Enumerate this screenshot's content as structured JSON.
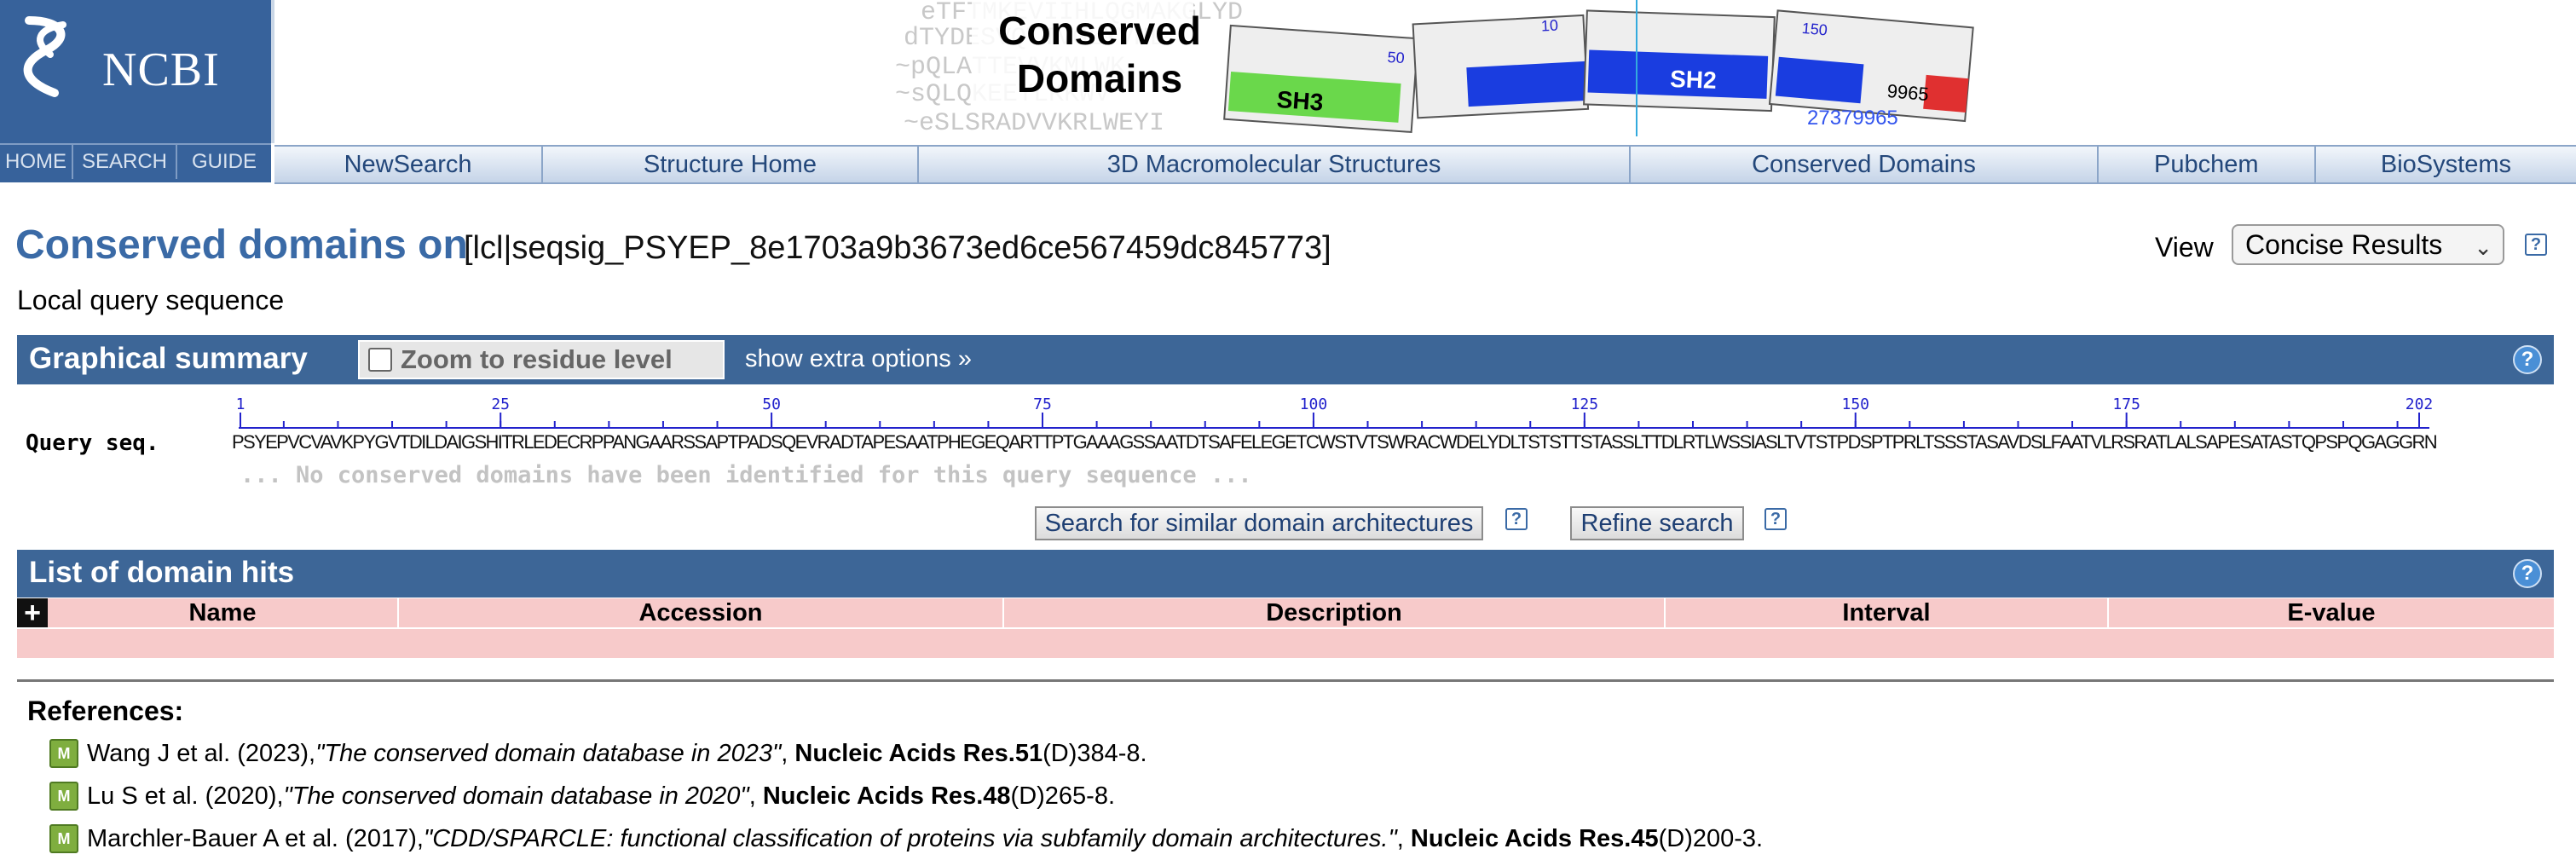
{
  "header": {
    "logo_text": "NCBI",
    "logo_nav": [
      {
        "label": "HOME"
      },
      {
        "label": "SEARCH"
      },
      {
        "label": "GUIDE"
      }
    ],
    "banner": {
      "title_line1": "Conserved",
      "title_line2": "Domains",
      "pieces": [
        "SH3",
        "SH2"
      ],
      "numbers": [
        "50",
        "10",
        "150",
        "9965",
        "27379965"
      ]
    },
    "main_nav": [
      {
        "label": "NewSearch"
      },
      {
        "label": "Structure Home"
      },
      {
        "label": "3D Macromolecular Structures"
      },
      {
        "label": "Conserved Domains"
      },
      {
        "label": "Pubchem"
      },
      {
        "label": "BioSystems"
      }
    ]
  },
  "title": {
    "heading": "Conserved domains on",
    "query_id": "[lcl|seqsig_PSYEP_8e1703a9b3673ed6ce567459dc845773]",
    "subtitle": "Local query sequence"
  },
  "view": {
    "label": "View",
    "selected": "Concise Results",
    "help": "?"
  },
  "graphical_summary": {
    "title": "Graphical summary",
    "zoom_label": "Zoom to residue level",
    "zoom_checked": false,
    "extra_options": "show extra options »",
    "help": "?",
    "ruler_labels": [
      "1",
      "25",
      "50",
      "75",
      "100",
      "125",
      "150",
      "175",
      "202"
    ],
    "query_label": "Query seq.",
    "sequence": "PSYEPVCVAVKPYGVTDILDAIGSHITRLEDECRPPANGAARSSAPTPADSQEVRADTAPESAATPHEGEQARTTPTGAAAGSSAATDTSAFELEGETCWSTVTSWRACWDELYDLTSTSTTSTASSLTTDLRTLWSSIASLTVTSTPDSPTPRLTSSSTASAVDSLFAATVLRSRATLALSAPESATASTQPSPQGAGGRN",
    "no_domains_message": "... No conserved domains have been identified for this query sequence ...",
    "search_similar_button": "Search for similar domain architectures",
    "refine_button": "Refine search",
    "button_help": "?"
  },
  "domain_hits": {
    "title": "List of domain hits",
    "help": "?",
    "expand_symbol": "+",
    "columns": [
      "Name",
      "Accession",
      "Description",
      "Interval",
      "E-value"
    ],
    "rows": []
  },
  "references": {
    "title": "References:",
    "icon_label": "M",
    "items": [
      {
        "authors": "Wang J et al. (2023), ",
        "title": "\"The conserved domain database in 2023\"",
        "sep": ", ",
        "journal": "Nucleic Acids Res.",
        "volume": "51",
        "pages": "(D)384-8."
      },
      {
        "authors": "Lu S et al. (2020), ",
        "title": "\"The conserved domain database in 2020\"",
        "sep": ", ",
        "journal": "Nucleic Acids Res.",
        "volume": "48",
        "pages": "(D)265-8."
      },
      {
        "authors": "Marchler-Bauer A et al. (2017), ",
        "title": "\"CDD/SPARCLE: functional classification of proteins via subfamily domain architectures.\"",
        "sep": ", ",
        "journal": "Nucleic Acids Res.",
        "volume": "45",
        "pages": "(D)200-3."
      }
    ]
  },
  "colors": {
    "ncbi_blue": "#37629b",
    "section_bar": "#3d6697",
    "title_blue": "#3a6aa6",
    "table_pink": "#f7caca",
    "ruler_blue": "#2222cc"
  }
}
